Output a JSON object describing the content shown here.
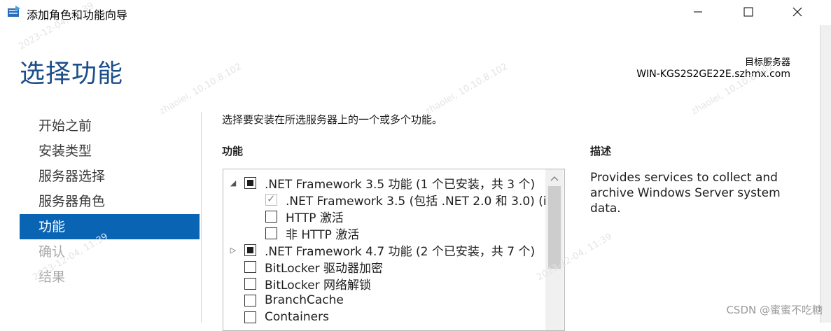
{
  "window": {
    "title": "添加角色和功能向导",
    "controls": {
      "minimize": "minimize-icon",
      "maximize": "maximize-icon",
      "close": "close-icon"
    }
  },
  "header": {
    "page_title": "选择功能",
    "target_label": "目标服务器",
    "target_value": "WIN-KGS2S2GE22E.szhmx.com"
  },
  "nav": {
    "items": [
      {
        "label": "开始之前",
        "state": "normal"
      },
      {
        "label": "安装类型",
        "state": "normal"
      },
      {
        "label": "服务器选择",
        "state": "normal"
      },
      {
        "label": "服务器角色",
        "state": "normal"
      },
      {
        "label": "功能",
        "state": "active"
      },
      {
        "label": "确认",
        "state": "disabled"
      },
      {
        "label": "结果",
        "state": "disabled"
      }
    ]
  },
  "main": {
    "instruction": "选择要安装在所选服务器上的一个或多个功能。",
    "features_label": "功能",
    "description_label": "描述",
    "description_text": "Provides services to collect and archive Windows Server system data.",
    "features": [
      {
        "label": ".NET Framework 3.5 功能 (1 个已安装，共 3 个)",
        "state": "partial",
        "expander": "expanded"
      },
      {
        "label": ".NET Framework 3.5 (包括 .NET 2.0 和 3.0) (i",
        "state": "checked-disabled",
        "expander": "none"
      },
      {
        "label": "HTTP 激活",
        "state": "unchecked",
        "expander": "none"
      },
      {
        "label": "非 HTTP 激活",
        "state": "unchecked",
        "expander": "none"
      },
      {
        "label": ".NET Framework 4.7 功能 (2 个已安装，共 7 个)",
        "state": "partial",
        "expander": "collapsed"
      },
      {
        "label": "BitLocker 驱动器加密",
        "state": "unchecked",
        "expander": "none"
      },
      {
        "label": "BitLocker 网络解锁",
        "state": "unchecked",
        "expander": "none"
      },
      {
        "label": "BranchCache",
        "state": "unchecked",
        "expander": "none"
      },
      {
        "label": "Containers",
        "state": "unchecked",
        "expander": "none"
      }
    ]
  },
  "watermark": {
    "text_1": "2023-12-04, 11:39",
    "text_2": "zhaolei, 10.10.8.102",
    "csdn": "CSDN @蜜蜜不吃糖"
  }
}
